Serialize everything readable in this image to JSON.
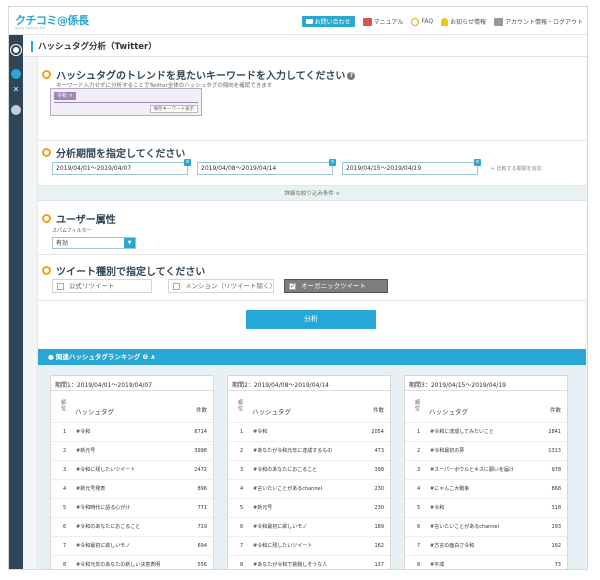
{
  "header": {
    "logo": "クチコミ@係長",
    "logo_sub": "Social Listening Tool",
    "nav": [
      {
        "label": "お問い合わせ",
        "icon": "mail-icon"
      },
      {
        "label": "マニュアル",
        "icon": "book-icon"
      },
      {
        "label": "FAQ",
        "icon": "question-icon"
      },
      {
        "label": "お知らせ情報",
        "icon": "bell-icon"
      },
      {
        "label": "アカウント情報・ログアウト",
        "icon": "account-icon"
      }
    ]
  },
  "sidebar": {
    "items": [
      "dashboard-icon",
      "twitter-icon",
      "tools-icon",
      "settings-icon"
    ]
  },
  "page": {
    "title": "ハッシュタグ分析（Twitter）"
  },
  "keyword_section": {
    "title": "ハッシュタグのトレンドを見たいキーワードを入力してください",
    "help": "?",
    "desc": "キーワード入力せずに分析することでTwitter全体のハッシュタグの傾向を確認できます",
    "chip": "令和 ×",
    "save_button": "保存キーワード表示"
  },
  "period_section": {
    "title": "分析期間を指定してください",
    "dates": [
      "2019/04/01～2019/04/07",
      "2019/04/08～2019/04/14",
      "2019/04/15～2019/04/19"
    ],
    "add_label": "＋ 比較する期間を追加",
    "detail_label": "詳細な絞り込み条件 ∨"
  },
  "user_section": {
    "title": "ユーザー属性",
    "spam_label": "スパムフィルター",
    "spam_value": "有効"
  },
  "tweet_section": {
    "title": "ツイート種別で指定してください",
    "options": [
      {
        "label": "公式リツイート",
        "checked": false
      },
      {
        "label": "メンション（リツイート除く）",
        "checked": false
      },
      {
        "label": "オーガニックツイート",
        "checked": true
      }
    ]
  },
  "analyze_button": "分析",
  "ranking": {
    "title": "● 関連ハッシュタグランキング ❷ ∧",
    "header_rank": "順\n位",
    "header_tag": "ハッシュタグ",
    "header_count": "件数",
    "columns": [
      {
        "period": "期間1：2019/04/01～2019/04/07",
        "rows": [
          {
            "rank": "1",
            "tag": "#令和",
            "count": "8714"
          },
          {
            "rank": "2",
            "tag": "#新元号",
            "count": "3998"
          },
          {
            "rank": "3",
            "tag": "#令和に残したいツイート",
            "count": "2472"
          },
          {
            "rank": "4",
            "tag": "#新元号発表",
            "count": "896"
          },
          {
            "rank": "5",
            "tag": "#令和時代に語る心がけ",
            "count": "771"
          },
          {
            "rank": "6",
            "tag": "#令和のあなたにおこること",
            "count": "719"
          },
          {
            "rank": "7",
            "tag": "#令和最初に欲しいモノ",
            "count": "694"
          },
          {
            "rank": "8",
            "tag": "#令和元年のあなたの新しい決意表明",
            "count": "556"
          }
        ]
      },
      {
        "period": "期間2：2019/04/08～2019/04/14",
        "rows": [
          {
            "rank": "1",
            "tag": "#令和",
            "count": "2054"
          },
          {
            "rank": "2",
            "tag": "#あなたが令和元年に達成するもの",
            "count": "473"
          },
          {
            "rank": "3",
            "tag": "#令和のあなたにおこること",
            "count": "398"
          },
          {
            "rank": "4",
            "tag": "#言いたいことがあるchannel",
            "count": "230"
          },
          {
            "rank": "5",
            "tag": "#新元号",
            "count": "230"
          },
          {
            "rank": "6",
            "tag": "#令和最初に欲しいモノ",
            "count": "189"
          },
          {
            "rank": "7",
            "tag": "#令和に残したいツイート",
            "count": "162"
          },
          {
            "rank": "8",
            "tag": "#あなたが令和で挑戦しそうな人",
            "count": "137"
          }
        ]
      },
      {
        "period": "期間3：2019/04/15～2019/04/19",
        "rows": [
          {
            "rank": "1",
            "tag": "#令和に達成してみたいこと",
            "count": "2841"
          },
          {
            "rank": "2",
            "tag": "#令和最初の夢",
            "count": "1313"
          },
          {
            "rank": "3",
            "tag": "#スーパーボウルとキスに願いを届け",
            "count": "978"
          },
          {
            "rank": "4",
            "tag": "#にゃんこ大戦争",
            "count": "868"
          },
          {
            "rank": "5",
            "tag": "#令和",
            "count": "318"
          },
          {
            "rank": "6",
            "tag": "#言いたいことがあるchannel",
            "count": "193"
          },
          {
            "rank": "7",
            "tag": "#方言の面白さ令和",
            "count": "192"
          },
          {
            "rank": "8",
            "tag": "#平成",
            "count": "73"
          }
        ]
      }
    ]
  },
  "colors": {
    "accent": "#2aa7cf",
    "sidebar": "#2f4658",
    "section_marker": "#f0a020"
  }
}
